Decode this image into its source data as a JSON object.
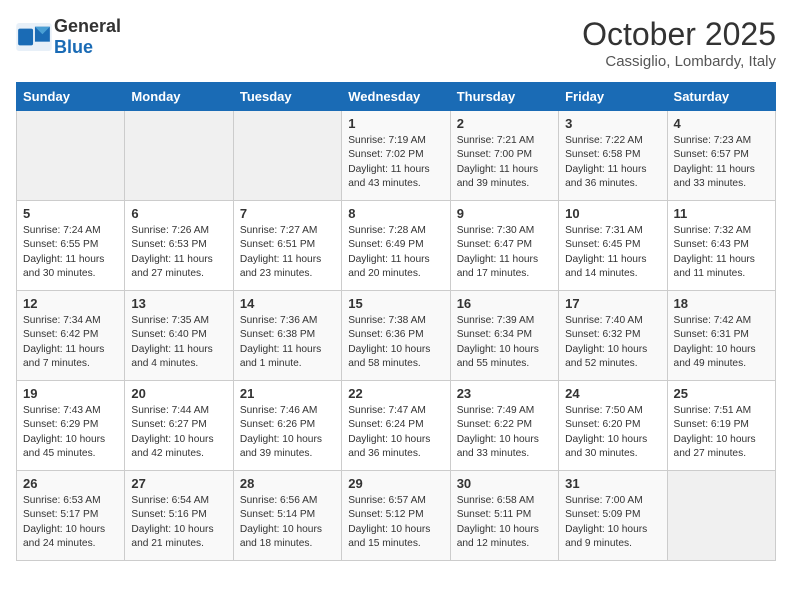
{
  "header": {
    "logo_general": "General",
    "logo_blue": "Blue",
    "month_title": "October 2025",
    "location": "Cassiglio, Lombardy, Italy"
  },
  "weekdays": [
    "Sunday",
    "Monday",
    "Tuesday",
    "Wednesday",
    "Thursday",
    "Friday",
    "Saturday"
  ],
  "weeks": [
    [
      {
        "day": "",
        "text": ""
      },
      {
        "day": "",
        "text": ""
      },
      {
        "day": "",
        "text": ""
      },
      {
        "day": "1",
        "text": "Sunrise: 7:19 AM\nSunset: 7:02 PM\nDaylight: 11 hours\nand 43 minutes."
      },
      {
        "day": "2",
        "text": "Sunrise: 7:21 AM\nSunset: 7:00 PM\nDaylight: 11 hours\nand 39 minutes."
      },
      {
        "day": "3",
        "text": "Sunrise: 7:22 AM\nSunset: 6:58 PM\nDaylight: 11 hours\nand 36 minutes."
      },
      {
        "day": "4",
        "text": "Sunrise: 7:23 AM\nSunset: 6:57 PM\nDaylight: 11 hours\nand 33 minutes."
      }
    ],
    [
      {
        "day": "5",
        "text": "Sunrise: 7:24 AM\nSunset: 6:55 PM\nDaylight: 11 hours\nand 30 minutes."
      },
      {
        "day": "6",
        "text": "Sunrise: 7:26 AM\nSunset: 6:53 PM\nDaylight: 11 hours\nand 27 minutes."
      },
      {
        "day": "7",
        "text": "Sunrise: 7:27 AM\nSunset: 6:51 PM\nDaylight: 11 hours\nand 23 minutes."
      },
      {
        "day": "8",
        "text": "Sunrise: 7:28 AM\nSunset: 6:49 PM\nDaylight: 11 hours\nand 20 minutes."
      },
      {
        "day": "9",
        "text": "Sunrise: 7:30 AM\nSunset: 6:47 PM\nDaylight: 11 hours\nand 17 minutes."
      },
      {
        "day": "10",
        "text": "Sunrise: 7:31 AM\nSunset: 6:45 PM\nDaylight: 11 hours\nand 14 minutes."
      },
      {
        "day": "11",
        "text": "Sunrise: 7:32 AM\nSunset: 6:43 PM\nDaylight: 11 hours\nand 11 minutes."
      }
    ],
    [
      {
        "day": "12",
        "text": "Sunrise: 7:34 AM\nSunset: 6:42 PM\nDaylight: 11 hours\nand 7 minutes."
      },
      {
        "day": "13",
        "text": "Sunrise: 7:35 AM\nSunset: 6:40 PM\nDaylight: 11 hours\nand 4 minutes."
      },
      {
        "day": "14",
        "text": "Sunrise: 7:36 AM\nSunset: 6:38 PM\nDaylight: 11 hours\nand 1 minute."
      },
      {
        "day": "15",
        "text": "Sunrise: 7:38 AM\nSunset: 6:36 PM\nDaylight: 10 hours\nand 58 minutes."
      },
      {
        "day": "16",
        "text": "Sunrise: 7:39 AM\nSunset: 6:34 PM\nDaylight: 10 hours\nand 55 minutes."
      },
      {
        "day": "17",
        "text": "Sunrise: 7:40 AM\nSunset: 6:32 PM\nDaylight: 10 hours\nand 52 minutes."
      },
      {
        "day": "18",
        "text": "Sunrise: 7:42 AM\nSunset: 6:31 PM\nDaylight: 10 hours\nand 49 minutes."
      }
    ],
    [
      {
        "day": "19",
        "text": "Sunrise: 7:43 AM\nSunset: 6:29 PM\nDaylight: 10 hours\nand 45 minutes."
      },
      {
        "day": "20",
        "text": "Sunrise: 7:44 AM\nSunset: 6:27 PM\nDaylight: 10 hours\nand 42 minutes."
      },
      {
        "day": "21",
        "text": "Sunrise: 7:46 AM\nSunset: 6:26 PM\nDaylight: 10 hours\nand 39 minutes."
      },
      {
        "day": "22",
        "text": "Sunrise: 7:47 AM\nSunset: 6:24 PM\nDaylight: 10 hours\nand 36 minutes."
      },
      {
        "day": "23",
        "text": "Sunrise: 7:49 AM\nSunset: 6:22 PM\nDaylight: 10 hours\nand 33 minutes."
      },
      {
        "day": "24",
        "text": "Sunrise: 7:50 AM\nSunset: 6:20 PM\nDaylight: 10 hours\nand 30 minutes."
      },
      {
        "day": "25",
        "text": "Sunrise: 7:51 AM\nSunset: 6:19 PM\nDaylight: 10 hours\nand 27 minutes."
      }
    ],
    [
      {
        "day": "26",
        "text": "Sunrise: 6:53 AM\nSunset: 5:17 PM\nDaylight: 10 hours\nand 24 minutes."
      },
      {
        "day": "27",
        "text": "Sunrise: 6:54 AM\nSunset: 5:16 PM\nDaylight: 10 hours\nand 21 minutes."
      },
      {
        "day": "28",
        "text": "Sunrise: 6:56 AM\nSunset: 5:14 PM\nDaylight: 10 hours\nand 18 minutes."
      },
      {
        "day": "29",
        "text": "Sunrise: 6:57 AM\nSunset: 5:12 PM\nDaylight: 10 hours\nand 15 minutes."
      },
      {
        "day": "30",
        "text": "Sunrise: 6:58 AM\nSunset: 5:11 PM\nDaylight: 10 hours\nand 12 minutes."
      },
      {
        "day": "31",
        "text": "Sunrise: 7:00 AM\nSunset: 5:09 PM\nDaylight: 10 hours\nand 9 minutes."
      },
      {
        "day": "",
        "text": ""
      }
    ]
  ]
}
